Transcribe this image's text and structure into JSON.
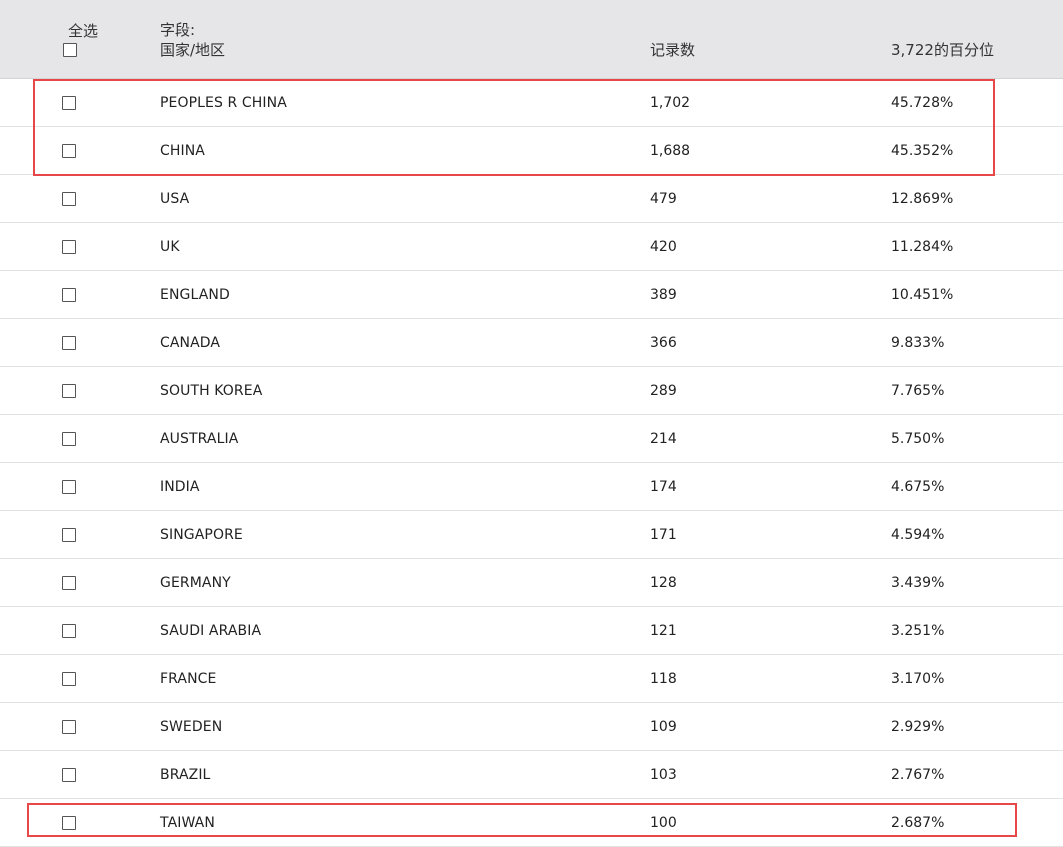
{
  "header": {
    "select_all_label": "全选",
    "field_label": "字段:",
    "field_value": "国家/地区",
    "records_label": "记录数",
    "percent_label": "3,722的百分位"
  },
  "rows": [
    {
      "name": "PEOPLES R CHINA",
      "count": "1,702",
      "percent": "45.728%"
    },
    {
      "name": "CHINA",
      "count": "1,688",
      "percent": "45.352%"
    },
    {
      "name": "USA",
      "count": "479",
      "percent": "12.869%"
    },
    {
      "name": "UK",
      "count": "420",
      "percent": "11.284%"
    },
    {
      "name": "ENGLAND",
      "count": "389",
      "percent": "10.451%"
    },
    {
      "name": "CANADA",
      "count": "366",
      "percent": "9.833%"
    },
    {
      "name": "SOUTH KOREA",
      "count": "289",
      "percent": "7.765%"
    },
    {
      "name": "AUSTRALIA",
      "count": "214",
      "percent": "5.750%"
    },
    {
      "name": "INDIA",
      "count": "174",
      "percent": "4.675%"
    },
    {
      "name": "SINGAPORE",
      "count": "171",
      "percent": "4.594%"
    },
    {
      "name": "GERMANY",
      "count": "128",
      "percent": "3.439%"
    },
    {
      "name": "SAUDI ARABIA",
      "count": "121",
      "percent": "3.251%"
    },
    {
      "name": "FRANCE",
      "count": "118",
      "percent": "3.170%"
    },
    {
      "name": "SWEDEN",
      "count": "109",
      "percent": "2.929%"
    },
    {
      "name": "BRAZIL",
      "count": "103",
      "percent": "2.767%"
    },
    {
      "name": "TAIWAN",
      "count": "100",
      "percent": "2.687%"
    }
  ],
  "highlight_color": "#e8474a"
}
